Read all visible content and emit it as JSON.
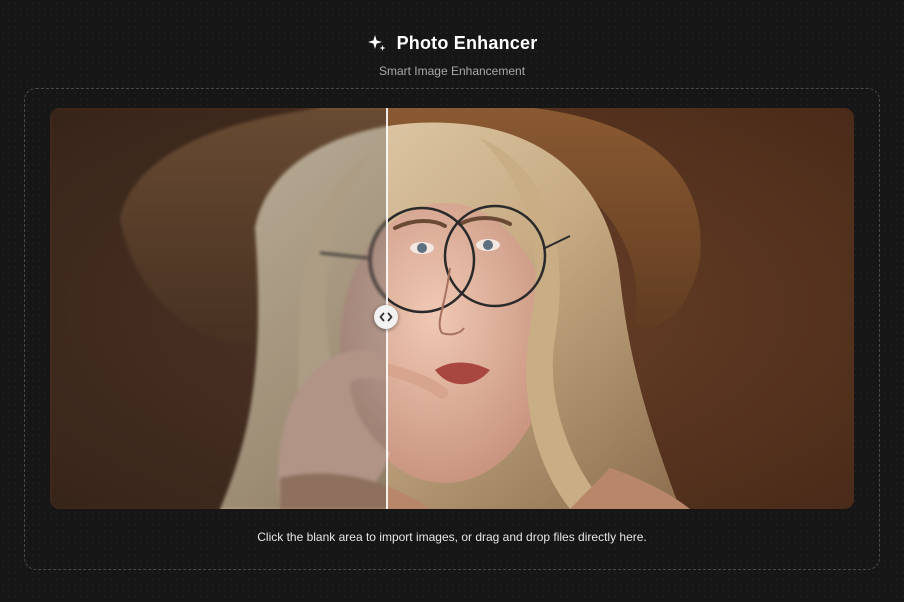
{
  "header": {
    "icon": "sparkle-icon",
    "title": "Photo Enhancer",
    "subtitle": "Smart Image Enhancement"
  },
  "comparison": {
    "before_label": "",
    "after_label": "",
    "slider_position_fraction": 0.42,
    "handle_icon": "arrows-left-right-icon",
    "background_color": "#57341f"
  },
  "dropzone": {
    "hint": "Click the blank area to import images, or drag and drop files directly here."
  },
  "colors": {
    "page_background": "#161616",
    "title": "#ffffff",
    "subtitle": "#a9a9a9",
    "dashed_border": "#4a4a4a"
  }
}
